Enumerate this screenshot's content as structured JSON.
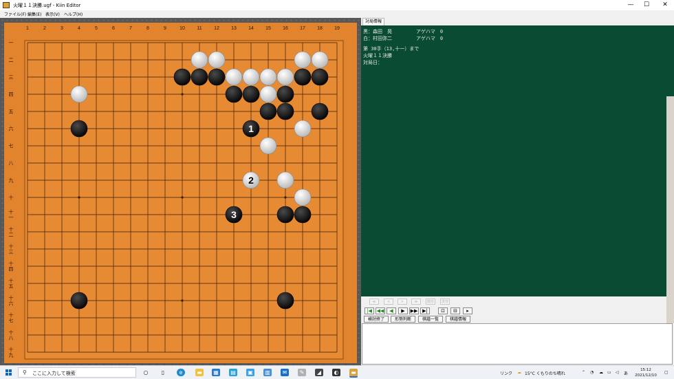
{
  "window": {
    "title": "火曜１１決勝.ugf - Kiin Editor"
  },
  "menu": [
    "ファイル(F)",
    "編集(E)",
    "表示(V)",
    "ヘルプ(H)"
  ],
  "board": {
    "size": 19,
    "col_labels": [
      "1",
      "2",
      "3",
      "4",
      "5",
      "6",
      "7",
      "8",
      "9",
      "10",
      "11",
      "12",
      "13",
      "14",
      "15",
      "16",
      "17",
      "18",
      "19"
    ],
    "row_labels": [
      "一",
      "二",
      "三",
      "四",
      "五",
      "六",
      "七",
      "八",
      "九",
      "十",
      "十一",
      "十二",
      "十三",
      "十四",
      "十五",
      "十六",
      "十七",
      "十八",
      "十九"
    ],
    "stones": [
      {
        "c": 11,
        "r": 2,
        "color": "white"
      },
      {
        "c": 12,
        "r": 2,
        "color": "white"
      },
      {
        "c": 17,
        "r": 2,
        "color": "white"
      },
      {
        "c": 18,
        "r": 2,
        "color": "white"
      },
      {
        "c": 10,
        "r": 3,
        "color": "black"
      },
      {
        "c": 11,
        "r": 3,
        "color": "black"
      },
      {
        "c": 12,
        "r": 3,
        "color": "black"
      },
      {
        "c": 13,
        "r": 3,
        "color": "white"
      },
      {
        "c": 14,
        "r": 3,
        "color": "white"
      },
      {
        "c": 15,
        "r": 3,
        "color": "white"
      },
      {
        "c": 16,
        "r": 3,
        "color": "white"
      },
      {
        "c": 17,
        "r": 3,
        "color": "black"
      },
      {
        "c": 18,
        "r": 3,
        "color": "black"
      },
      {
        "c": 4,
        "r": 4,
        "color": "white"
      },
      {
        "c": 13,
        "r": 4,
        "color": "black"
      },
      {
        "c": 14,
        "r": 4,
        "color": "black"
      },
      {
        "c": 15,
        "r": 4,
        "color": "white"
      },
      {
        "c": 16,
        "r": 4,
        "color": "black"
      },
      {
        "c": 15,
        "r": 5,
        "color": "black"
      },
      {
        "c": 16,
        "r": 5,
        "color": "black"
      },
      {
        "c": 18,
        "r": 5,
        "color": "black"
      },
      {
        "c": 4,
        "r": 6,
        "color": "black"
      },
      {
        "c": 14,
        "r": 6,
        "color": "black",
        "label": "1"
      },
      {
        "c": 17,
        "r": 6,
        "color": "white"
      },
      {
        "c": 15,
        "r": 7,
        "color": "white"
      },
      {
        "c": 14,
        "r": 9,
        "color": "white",
        "label": "2"
      },
      {
        "c": 16,
        "r": 9,
        "color": "white"
      },
      {
        "c": 17,
        "r": 10,
        "color": "white"
      },
      {
        "c": 13,
        "r": 11,
        "color": "black",
        "label": "3"
      },
      {
        "c": 16,
        "r": 11,
        "color": "black"
      },
      {
        "c": 17,
        "r": 11,
        "color": "black"
      },
      {
        "c": 4,
        "r": 16,
        "color": "black"
      },
      {
        "c": 16,
        "r": 16,
        "color": "black"
      }
    ]
  },
  "panel": {
    "tab": "対局情報",
    "lines": [
      "黒：森田　晃　　　　　アゲハマ　0",
      "白：村田弥二　　　　　アゲハマ　0",
      "第 30手（13,十一）まで",
      "火曜１１決勝",
      "対局日："
    ]
  },
  "controls": {
    "small_buttons": [
      "≪",
      "<",
      ">",
      "≫",
      "前分",
      "次分"
    ],
    "nav_buttons": [
      "|◀",
      "◀◀",
      "◀",
      "▶",
      "▶▶",
      "▶|",
      "⊡",
      "⊟",
      "▸"
    ],
    "commands": [
      "検討終了",
      "形勢判断",
      "棋譜一覧",
      "棋譜情報"
    ]
  },
  "taskbar": {
    "search_placeholder": "ここに入力して検索",
    "link_label": "リンク",
    "weather": "15°C くもりのち晴れ",
    "ime": "あ",
    "time": "15:12",
    "date": "2021/12/10"
  }
}
